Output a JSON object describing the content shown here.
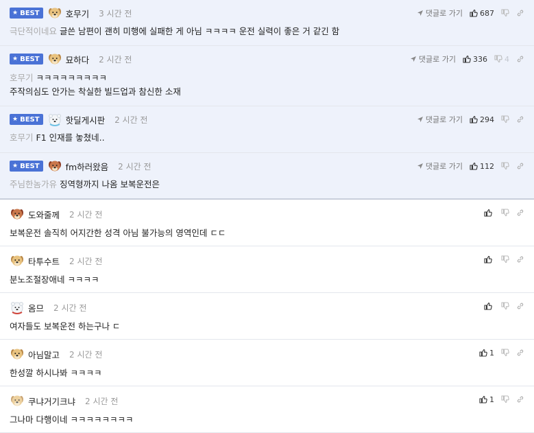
{
  "best_label": "BEST",
  "reply_label": "댓글로 가기",
  "best": [
    {
      "nick": "호무기",
      "time": "3 시간 전",
      "reply_to": "극단적이네요",
      "text": "글쓴 남편이 괜히 미행에 실패한 게 아님 ㅋㅋㅋㅋ 운전 실력이 좋은 거 같긴 함",
      "likes": "687",
      "dislikes": "",
      "avatar": "dog"
    },
    {
      "nick": "묘하다",
      "time": "2 시간 전",
      "reply_to": "호무기",
      "text": "주작의심도 안가는 착실한 빌드업과 참신한 소재",
      "reply_text": "ㅋㅋㅋㅋㅋㅋㅋㅋㅋ",
      "likes": "336",
      "dislikes": "4",
      "avatar": "dog"
    },
    {
      "nick": "핫딜게시판",
      "time": "2 시간 전",
      "reply_to": "호무기",
      "text": "F1 인재를 놓쳤네..",
      "likes": "294",
      "dislikes": "",
      "avatar": "bear"
    },
    {
      "nick": "fm하러왔음",
      "time": "2 시간 전",
      "reply_to": "주님한놈가유",
      "text": "징역형까지 나옴 보복운전은",
      "likes": "112",
      "dislikes": "",
      "avatar": "reddog"
    }
  ],
  "comments": [
    {
      "nick": "도와줄께",
      "time": "2 시간 전",
      "text": "보복운전 솔직히 어지간한 성격 아님 불가능의 영역인데 ㄷㄷ",
      "likes": "",
      "avatar": "reddog"
    },
    {
      "nick": "타투수트",
      "time": "2 시간 전",
      "text": "분노조절장애네 ㅋㅋㅋㅋ",
      "likes": "",
      "avatar": "dog"
    },
    {
      "nick": "옴므",
      "time": "2 시간 전",
      "text": "여자들도 보복운전 하는구나 ㄷ",
      "likes": "",
      "avatar": "bear2"
    },
    {
      "nick": "아님말고",
      "time": "2 시간 전",
      "text": "한성깔 하시나봐 ㅋㅋㅋㅋ",
      "likes": "1",
      "avatar": "dog"
    },
    {
      "nick": "쿠냐거기크냐",
      "time": "2 시간 전",
      "text": "그나마 다행이네 ㅋㅋㅋㅋㅋㅋㅋㅋ",
      "likes": "1",
      "avatar": "dogblur"
    }
  ]
}
